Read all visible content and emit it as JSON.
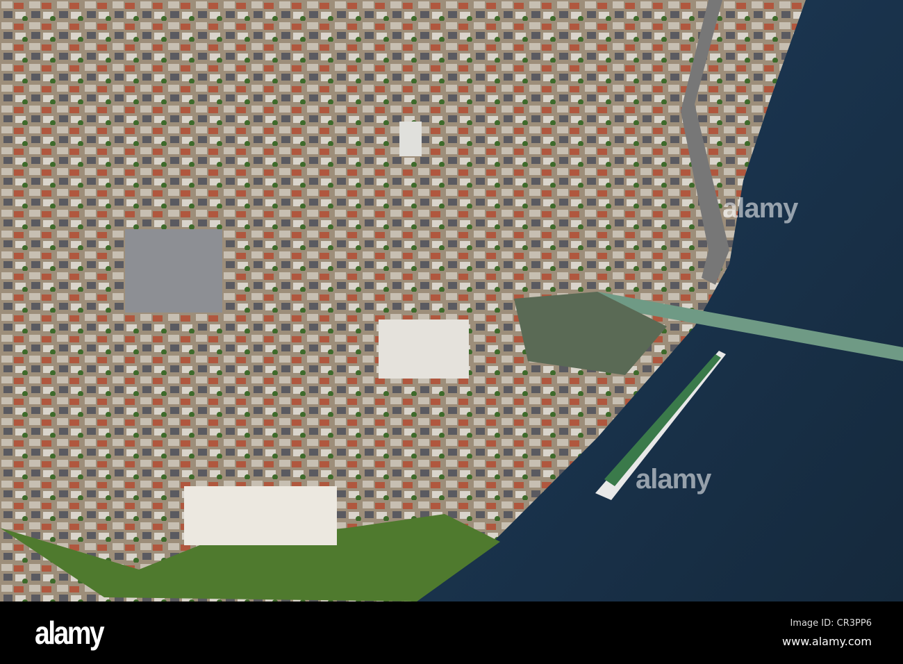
{
  "photo": {
    "subject": "aerial-town-river"
  },
  "watermark": {
    "text": "alamy"
  },
  "footer": {
    "logo": "alamy",
    "image_id": "Image ID: CR3PP6",
    "website": "www.alamy.com"
  },
  "colors": {
    "river": "#1a3550",
    "city": "#a89880",
    "greenery": "#3f6b2a",
    "footer": "#000000"
  }
}
